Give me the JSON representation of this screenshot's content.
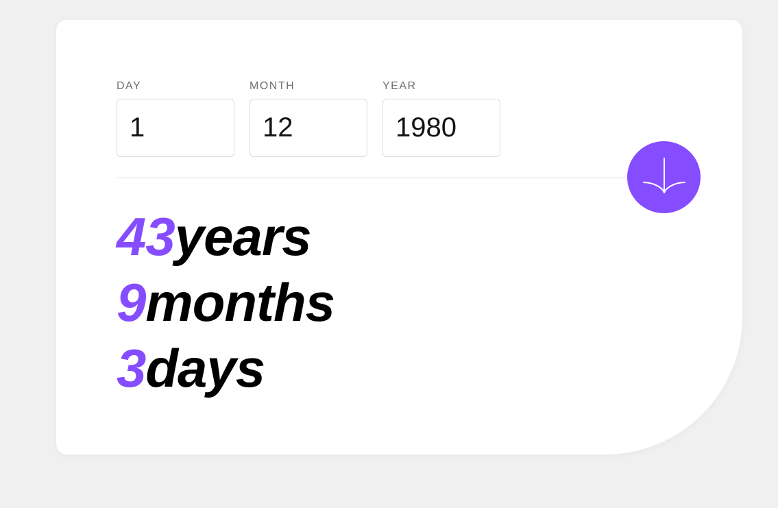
{
  "form": {
    "day": {
      "label": "DAY",
      "value": "1"
    },
    "month": {
      "label": "MONTH",
      "value": "12"
    },
    "year": {
      "label": "YEAR",
      "value": "1980"
    }
  },
  "submit": {
    "icon": "arrow-down-icon"
  },
  "results": {
    "years": {
      "value": "43",
      "unit": "years"
    },
    "months": {
      "value": "9",
      "unit": "months"
    },
    "days": {
      "value": "3",
      "unit": "days"
    }
  },
  "colors": {
    "accent": "#854dff",
    "background": "#f0f0f0",
    "card": "#ffffff",
    "label": "#716f6f",
    "text": "#000000"
  }
}
